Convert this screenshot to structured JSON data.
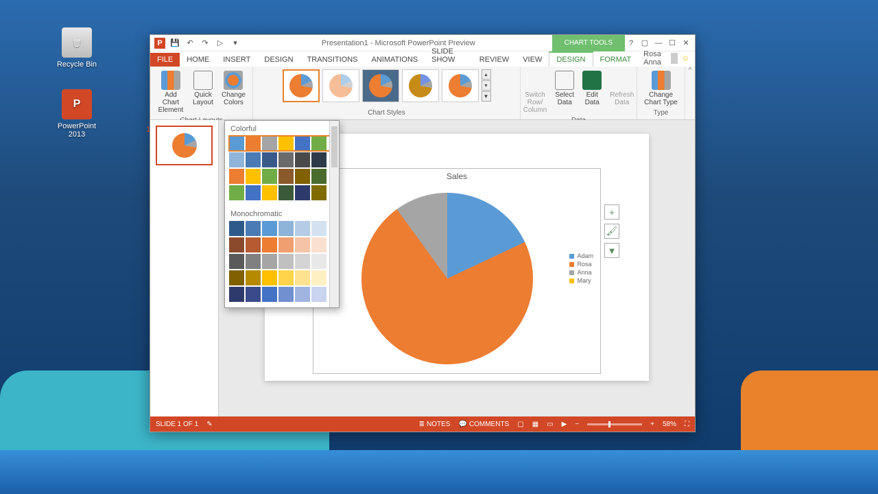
{
  "desktop": {
    "recycle_label": "Recycle Bin",
    "ppt_label": "PowerPoint 2013"
  },
  "titlebar": {
    "title": "Presentation1 - Microsoft PowerPoint Preview",
    "context_title": "CHART TOOLS"
  },
  "tabs": {
    "file": "FILE",
    "home": "HOME",
    "insert": "INSERT",
    "design": "DESIGN",
    "transitions": "TRANSITIONS",
    "animations": "ANIMATIONS",
    "slideshow": "SLIDE SHOW",
    "review": "REVIEW",
    "view": "VIEW",
    "ctx_design": "DESIGN",
    "ctx_format": "FORMAT",
    "user": "Rosa Anna"
  },
  "ribbon": {
    "add_element": "Add Chart Element",
    "quick_layout": "Quick Layout",
    "change_colors": "Change Colors",
    "group_layouts": "Chart Layouts",
    "group_styles": "Chart Styles",
    "switch": "Switch Row/ Column",
    "select_data": "Select Data",
    "edit_data": "Edit Data",
    "refresh": "Refresh Data",
    "group_data": "Data",
    "change_type": "Change Chart Type",
    "group_type": "Type"
  },
  "color_dropdown": {
    "colorful": "Colorful",
    "mono": "Monochromatic",
    "colorful_rows": [
      [
        "#5b9bd5",
        "#ed7d31",
        "#a5a5a5",
        "#ffc000",
        "#4472c4",
        "#70ad47"
      ],
      [
        "#8fb4d9",
        "#4a7bb5",
        "#3a5a8a",
        "#6b6b6b",
        "#4a4a4a",
        "#2e3a4a"
      ],
      [
        "#ed7d31",
        "#ffc000",
        "#70ad47",
        "#8b5a2b",
        "#806000",
        "#4a6b2e"
      ],
      [
        "#70ad47",
        "#4472c4",
        "#ffc000",
        "#3a5a3a",
        "#2e3a6b",
        "#806b00"
      ]
    ],
    "mono_rows": [
      [
        "#2e5a8a",
        "#4a7bb5",
        "#5b9bd5",
        "#8fb4d9",
        "#b5cce6",
        "#d4e1f0"
      ],
      [
        "#8b4a2b",
        "#b55a31",
        "#ed7d31",
        "#f0a070",
        "#f5c4a8",
        "#fae0d0"
      ],
      [
        "#5a5a5a",
        "#808080",
        "#a5a5a5",
        "#c0c0c0",
        "#d4d4d4",
        "#e8e8e8"
      ],
      [
        "#806000",
        "#b58a00",
        "#ffc000",
        "#ffd44a",
        "#ffe28f",
        "#fff0c4"
      ],
      [
        "#2e3a6b",
        "#3a4a8a",
        "#4472c4",
        "#7090d0",
        "#a0b4e0",
        "#c8d4f0"
      ]
    ]
  },
  "slide": {
    "number": "1"
  },
  "chart_data": {
    "type": "pie",
    "title": "Sales",
    "series": [
      {
        "name": "Adam",
        "value": 18,
        "color": "#5b9bd5"
      },
      {
        "name": "Rosa",
        "value": 72,
        "color": "#ed7d31"
      },
      {
        "name": "Anna",
        "value": 10,
        "color": "#a5a5a5"
      },
      {
        "name": "Mary",
        "value": 0,
        "color": "#ffc000"
      }
    ]
  },
  "statusbar": {
    "slide": "SLIDE 1 OF 1",
    "notes": "NOTES",
    "comments": "COMMENTS",
    "zoom": "58%"
  }
}
